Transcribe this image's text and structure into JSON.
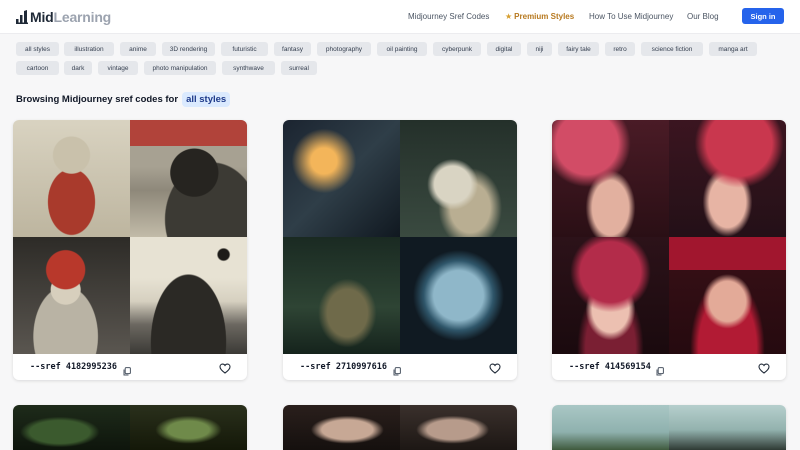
{
  "header": {
    "logo_bold": "Mid",
    "logo_light": "Learning",
    "nav": [
      {
        "label": "Midjourney Sref Codes"
      },
      {
        "label": "Premium Styles",
        "icon": "star-icon"
      },
      {
        "label": "How To Use Midjourney"
      },
      {
        "label": "Our Blog"
      }
    ],
    "signin_label": "Sign in",
    "accent_color": "#2563eb",
    "premium_color": "#b7791f"
  },
  "tags": [
    "all styles",
    "illustration",
    "anime",
    "3D rendering",
    "futuristic",
    "fantasy",
    "photography",
    "oil painting",
    "cyberpunk",
    "digital",
    "niji",
    "fairy tale",
    "retro",
    "science fiction",
    "manga art",
    "cartoon",
    "dark",
    "vintage",
    "photo manipulation",
    "synthwave",
    "surreal"
  ],
  "browse": {
    "prefix": "Browsing Midjourney sref codes for",
    "selected": "all styles"
  },
  "cards": [
    {
      "code": "--sref 4182995236"
    },
    {
      "code": "--sref 2710997616"
    },
    {
      "code": "--sref 414569154"
    }
  ],
  "icons": {
    "copy": "copy-icon",
    "like": "heart-icon"
  }
}
